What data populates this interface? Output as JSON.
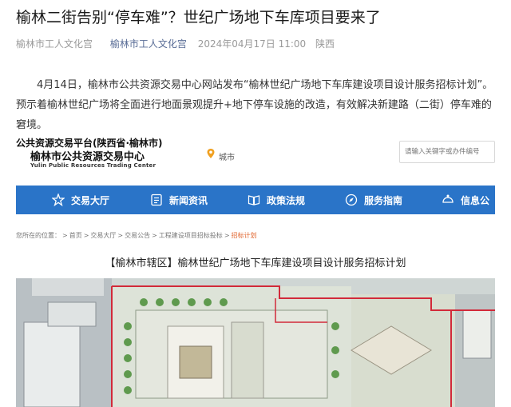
{
  "article": {
    "title": "榆林二街告别“停车难”？世纪广场地下车库项目要来了",
    "source": "榆林市工人文化宫",
    "account": "榆林市工人文化宫",
    "date": "2024年04月17日 11:00",
    "region": "陕西",
    "paragraph": "4月14日，榆林市公共资源交易中心网站发布“榆林世纪广场地下车库建设项目设计服务招标计划”。预示着榆林世纪广场将全面进行地面景观提升+地下停车设施的改造，有效解决新建路（二街）停车难的窘境。"
  },
  "site": {
    "logo_line1": "公共资源交易平台(陕西省·榆林市)",
    "logo_line2": "榆林市公共资源交易中心",
    "logo_en": "Yulin Public Resources Trading Center",
    "location": "城市",
    "search_placeholder": "请输入关键字或办件编号",
    "nav": [
      {
        "label": "交易大厅",
        "icon": "star-icon"
      },
      {
        "label": "新闻资讯",
        "icon": "news-icon"
      },
      {
        "label": "政策法规",
        "icon": "book-icon"
      },
      {
        "label": "服务指南",
        "icon": "compass-icon"
      },
      {
        "label": "信息公",
        "icon": "info-icon"
      }
    ],
    "breadcrumb": {
      "prefix": "您所在的位置：",
      "items": [
        "首页",
        "交易大厅",
        "交易公告",
        "工程建设项目招标投标"
      ],
      "current": "招标计划"
    },
    "doc_title": "【榆林市辖区】榆林世纪广场地下车库建设项目设计服务招标计划"
  },
  "colors": {
    "nav_bg": "#2a74c8",
    "account_link": "#576b95",
    "breadcrumb_current": "#e0632b",
    "plan_outline": "#d22a3a"
  }
}
